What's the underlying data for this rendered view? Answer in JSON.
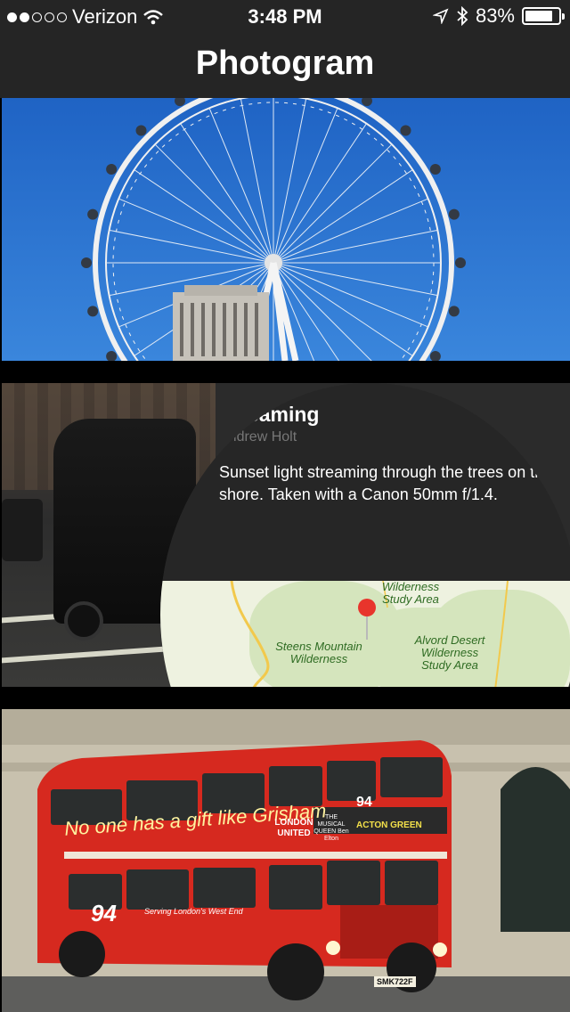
{
  "status_bar": {
    "carrier": "Verizon",
    "time": "3:48 PM",
    "battery_text": "83%",
    "battery_level": 0.83,
    "signal_bars_filled": 2,
    "signal_bars_total": 5
  },
  "nav": {
    "title": "Photogram"
  },
  "feed": {
    "photos": [
      {
        "subject": "Ferris wheel"
      },
      {
        "title": "Streaming",
        "author": "Andrew Holt",
        "description": "Sunset light streaming through the trees on the shore. Taken with a Canon 50mm f/1.4.",
        "map": {
          "labels": [
            "Wilderness Study Area",
            "Steens Mountain Wilderness",
            "Alvord Desert Wilderness Study Area"
          ]
        }
      },
      {
        "subject": "Red double-decker bus",
        "bus": {
          "ad": "No one has a gift like Grisham",
          "operator": "LONDON UNITED",
          "show": "THE MUSICAL QUEEN Ben Elton",
          "route_number": "94",
          "destination": "ACTON GREEN",
          "side_text": "Serving London's West End",
          "plate": "SMK722F"
        }
      }
    ]
  },
  "colors": {
    "bar_bg": "#252525",
    "accent_pin": "#e8352c",
    "bus_red": "#d6291f",
    "sky": "#2f74d0"
  }
}
